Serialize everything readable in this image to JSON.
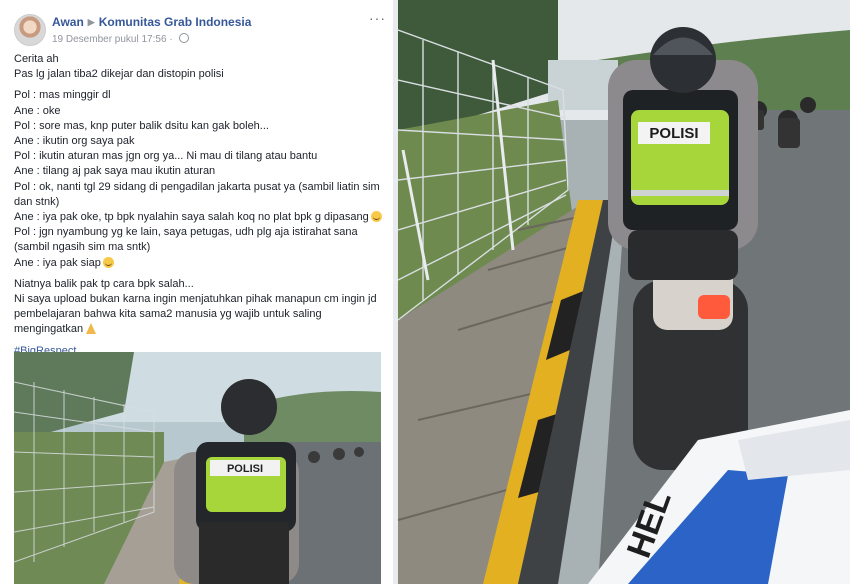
{
  "post": {
    "author": "Awan",
    "separator_glyph": "▶",
    "group": "Komunitas Grab Indonesia",
    "timestamp": "19 Desember pukul 17:56",
    "separator_dot": "·",
    "more_glyph": "···",
    "lines": [
      "Cerita ah",
      "Pas lg jalan tiba2 dikejar dan distopin polisi",
      "",
      "Pol : mas minggir dl",
      "Ane : oke",
      "Pol : sore mas, knp puter balik dsitu kan gak boleh...",
      "Ane : ikutin org saya pak",
      "Pol : ikutin aturan mas jgn org ya... Ni mau di tilang atau bantu",
      "Ane : tilang aj pak saya mau ikutin aturan",
      "Pol : ok, nanti tgl 29 sidang di pengadilan jakarta pusat ya (sambil liatin sim",
      "dan stnk)",
      "Ane : iya pak oke, tp bpk nyalahin saya salah koq no plat bpk g dipasang",
      "Pol : jgn nyambung yg ke lain, saya petugas, udh plg aja istirahat sana",
      "(sambil ngasih sim ma sntk)",
      "Ane : iya pak siap",
      "",
      "Niatnya balik pak tp cara bpk salah...",
      "Ni saya upload bukan karna ingin menjatuhkan pihak manapun cm ingin jd",
      "pembelajaran bahwa kita sama2 manusia yg wajib untuk saling",
      "mengingatkan"
    ],
    "hashtag": "#BigRespect"
  },
  "photo": {
    "vest_text": "POLISI",
    "helmet_text": "HEL"
  },
  "colors": {
    "link_blue": "#365899",
    "text": "#1d2129",
    "meta_gray": "#90949c",
    "vest_green": "#a6d63a"
  },
  "icons": [
    "avatar",
    "globe-icon",
    "more-icon",
    "smile-emoji-icon",
    "pray-emoji-icon"
  ]
}
